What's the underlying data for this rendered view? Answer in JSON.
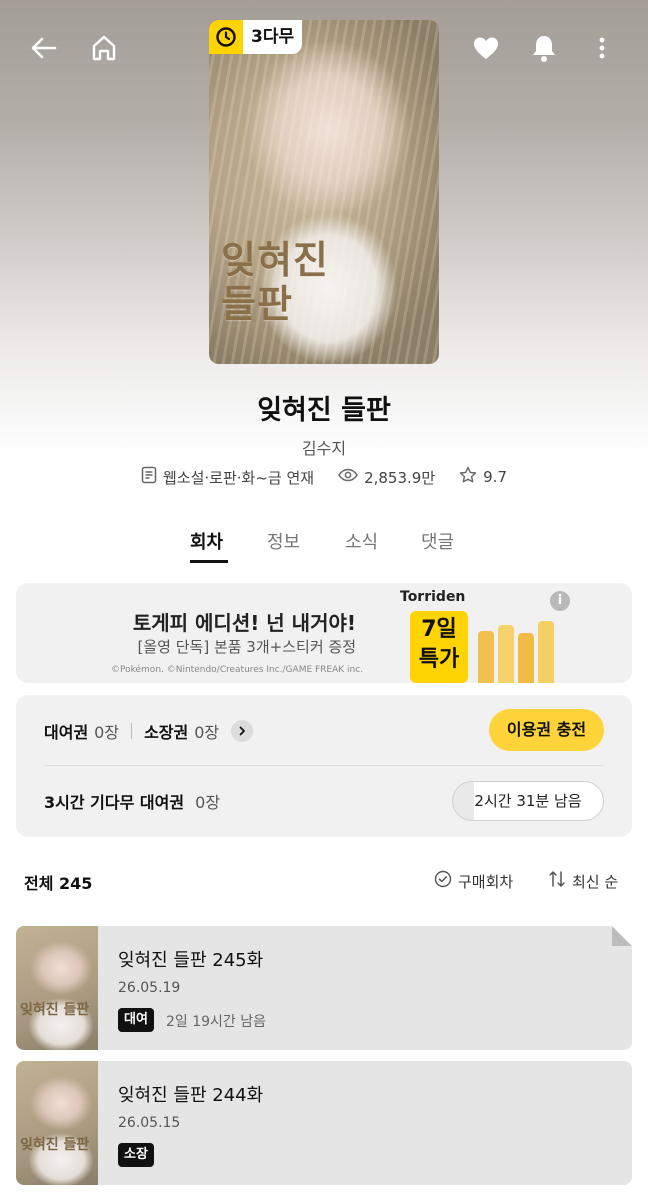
{
  "header": {
    "icons": [
      "back-arrow-icon",
      "home-icon",
      "heart-icon",
      "bell-icon",
      "more-vertical-icon"
    ]
  },
  "cover": {
    "badge": "3다무",
    "cover_title": "잊혀진 들판"
  },
  "work": {
    "title": "잊혀진 들판",
    "author": "김수지",
    "genre": "웹소설·로판·화~금 연재",
    "views": "2,853.9만",
    "rating": "9.7"
  },
  "tabs": [
    {
      "label": "회차",
      "active": true
    },
    {
      "label": "정보",
      "active": false
    },
    {
      "label": "소식",
      "active": false
    },
    {
      "label": "댓글",
      "active": false
    }
  ],
  "ad": {
    "title": "토게피 에디션! 넌 내거야!",
    "subtitle": "[올영 단독] 본품 3개+스티커 증정",
    "copyright": "©Pokémon. ©Nintendo/Creatures Inc./GAME FREAK inc.",
    "brand": "Torriden",
    "promo": "7일",
    "promo2": "특가",
    "info": "i"
  },
  "tickets": {
    "rental_label": "대여권",
    "rental_count": "0장",
    "owned_label": "소장권",
    "owned_count": "0장",
    "charge_button": "이용권 충전",
    "wait_label": "3시간 기다무 대여권",
    "wait_count": "0장",
    "wait_remaining": "2시간 31분 남음"
  },
  "list": {
    "total": "전체 245",
    "purchased_filter": "구매회차",
    "sort": "최신 순"
  },
  "episodes": [
    {
      "title": "잊혀진 들판 245화",
      "date": "26.05.19",
      "tag": "대여",
      "remain": "2일 19시간 남음"
    },
    {
      "title": "잊혀진 들판 244화",
      "date": "26.05.15",
      "tag": "소장",
      "remain": ""
    }
  ],
  "colors": {
    "accent": "#ffd33a",
    "wait_badge": "#ffd400",
    "tag_bg": "#111111"
  }
}
